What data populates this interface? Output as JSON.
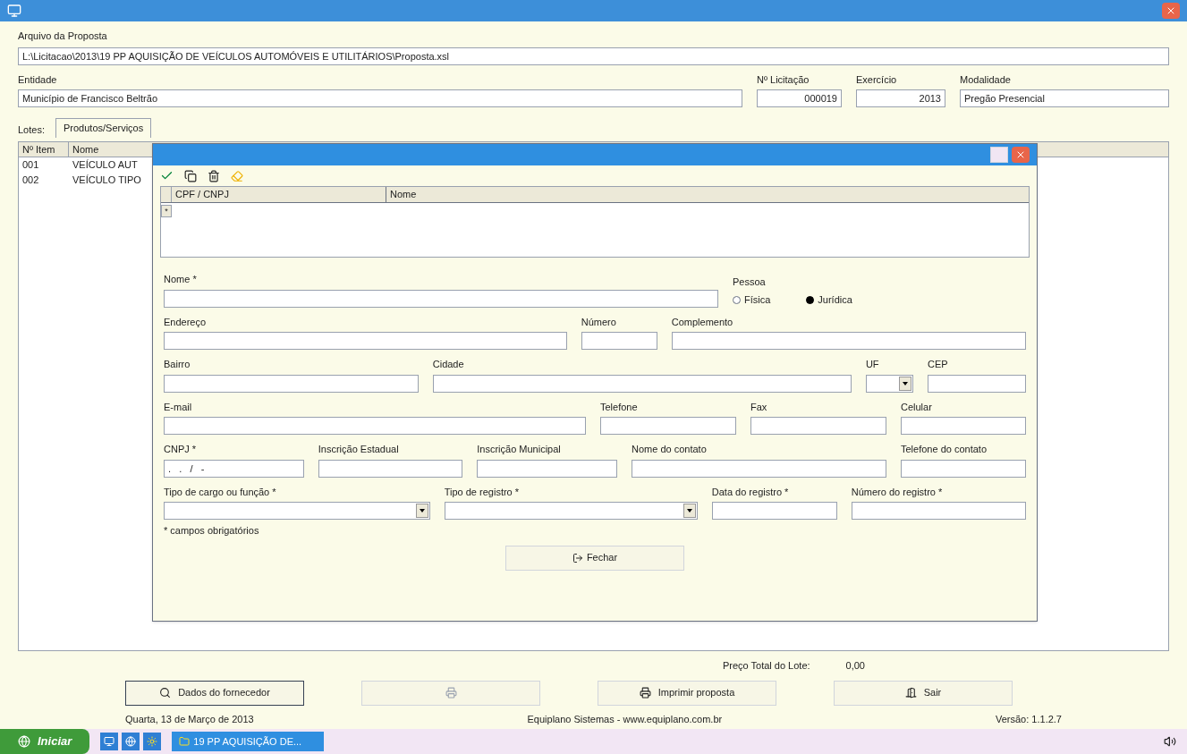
{
  "main": {
    "labels": {
      "file": "Arquivo da Proposta",
      "entity": "Entidade",
      "bid_no": "Nº Licitação",
      "year": "Exercício",
      "modality": "Modalidade",
      "lots": "Lotes:",
      "total": "Preço Total do Lote:"
    },
    "file_path": "L:\\Licitacao\\2013\\19 PP AQUISIÇÃO DE VEÍCULOS AUTOMÓVEIS E UTILITÁRIOS\\Proposta.xsl",
    "entity": "Município de Francisco Beltrão",
    "bid_no": "000019",
    "year": "2013",
    "modality": "Pregão Presencial",
    "tabs": [
      {
        "label": "Produtos/Serviços",
        "selected": true
      }
    ],
    "table": {
      "columns": [
        "Nº Item",
        "Nome"
      ],
      "rows": [
        [
          "001",
          "VEÍCULO AUT"
        ],
        [
          "002",
          "VEÍCULO TIPO"
        ]
      ]
    },
    "total": "0,00",
    "buttons": [
      {
        "kind": "supplier",
        "label": "Dados do fornecedor"
      },
      {
        "kind": "blank"
      },
      {
        "kind": "print",
        "label": "Imprimir proposta"
      },
      {
        "kind": "exit",
        "label": "Sair"
      }
    ],
    "status": [
      "Quarta, 13 de Março de 2013",
      "Equiplano Sistemas - www.equiplano.com.br",
      "Versão: 1.1.2.7"
    ]
  },
  "dialog": {
    "grid": {
      "columns": [
        "CPF / CNPJ",
        "Nome"
      ],
      "row_marker": "*"
    },
    "rows": [
      [
        {
          "kind": "text",
          "label": "Nome *"
        },
        {
          "kind": "radio_group",
          "label": "Pessoa",
          "options": [
            {
              "label": "Física",
              "selected": false
            },
            {
              "label": "Jurídica",
              "selected": true
            }
          ]
        }
      ],
      [
        {
          "kind": "text",
          "label": "Endereço"
        },
        {
          "kind": "text",
          "label": "Número"
        },
        {
          "kind": "text",
          "label": "Complemento"
        }
      ],
      [
        {
          "kind": "text",
          "label": "Bairro"
        },
        {
          "kind": "text",
          "label": "Cidade"
        },
        {
          "kind": "combo",
          "label": "UF"
        },
        {
          "kind": "text",
          "label": "CEP"
        }
      ],
      [
        {
          "kind": "text",
          "label": "E-mail"
        },
        {
          "kind": "text",
          "label": "Telefone"
        },
        {
          "kind": "text",
          "label": "Fax"
        },
        {
          "kind": "text",
          "label": "Celular"
        }
      ],
      [
        {
          "kind": "text",
          "label": "CNPJ *",
          "value": ".   .   /   -"
        },
        {
          "kind": "text",
          "label": "Inscrição Estadual"
        },
        {
          "kind": "text",
          "label": "Inscrição Municipal"
        },
        {
          "kind": "text",
          "label": "Nome do contato"
        },
        {
          "kind": "text",
          "label": "Telefone do contato"
        }
      ],
      [
        {
          "kind": "combo",
          "label": "Tipo de cargo ou função *"
        },
        {
          "kind": "combo",
          "label": "Tipo de registro *"
        },
        {
          "kind": "text",
          "label": "Data do registro *"
        },
        {
          "kind": "text",
          "label": "Número do registro *"
        }
      ]
    ],
    "note": "* campos obrigatórios",
    "close": "Fechar"
  },
  "taskbar": {
    "start": "Iniciar",
    "tasks": [
      "19 PP AQUISIÇÃO DE..."
    ]
  }
}
